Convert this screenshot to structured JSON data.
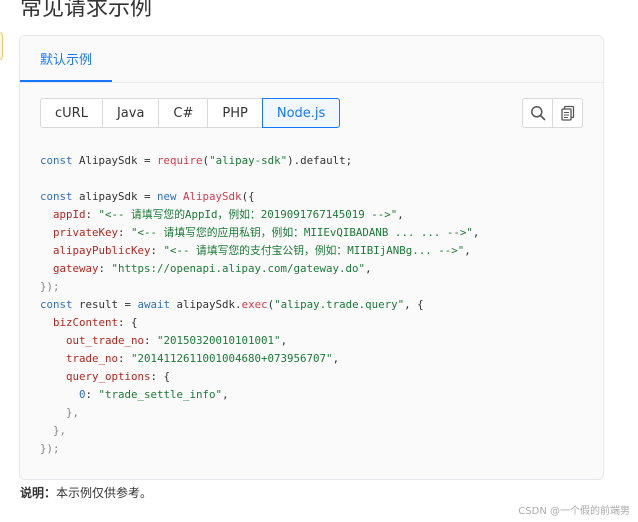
{
  "page": {
    "title": "常见请求示例"
  },
  "card": {
    "tab_label": "默认示例"
  },
  "languages": [
    "cURL",
    "Java",
    "C#",
    "PHP",
    "Node.js"
  ],
  "active_language": "Node.js",
  "code": {
    "l1": {
      "kw": "const",
      "a": " AlipaySdk = ",
      "fn": "require",
      "s": "\"alipay-sdk\"",
      "b": ").default;"
    },
    "l2": {
      "kw": "const",
      "a": " alipaySdk = ",
      "kw2": "new",
      "fn": " AlipaySdk",
      "b": "({"
    },
    "l3": {
      "prop": "appId",
      "str": "\"<-- 请填写您的AppId，例如：2019091767145019 -->\""
    },
    "l4": {
      "prop": "privateKey",
      "str": "\"<-- 请填写您的应用私钥，例如：MIIEvQIBADANB ... ... -->\""
    },
    "l5": {
      "prop": "alipayPublicKey",
      "str": "\"<-- 请填写您的支付宝公钥，例如：MIIBIjANBg... -->\""
    },
    "l6": {
      "prop": "gateway",
      "str": "\"https://openapi.alipay.com/gateway.do\""
    },
    "l7": "});",
    "l8": {
      "kw": "const",
      "a": " result = ",
      "kw2": "await",
      "b": " alipaySdk.",
      "fn": "exec",
      "s": "\"alipay.trade.query\"",
      "c": ", {"
    },
    "l9": {
      "prop": "bizContent",
      "b": ": {"
    },
    "l10": {
      "prop": "out_trade_no",
      "str": "\"20150320010101001\""
    },
    "l11": {
      "prop": "trade_no",
      "str": "\"2014112611001004680+073956707\""
    },
    "l12": {
      "prop": "query_options",
      "b": ": {"
    },
    "l13": {
      "num": "0",
      "str": "\"trade_settle_info\""
    },
    "l14": "},",
    "l15": "},",
    "l16": "});"
  },
  "note": {
    "label": "说明：",
    "text": "本示例仅供参考。"
  },
  "watermark": "CSDN @一个假的前端男",
  "colors": {
    "accent": "#1677ff",
    "keyword": "#2f6fbf",
    "string": "#1a7a36",
    "property": "#b5261e",
    "function": "#d73a49"
  },
  "icons": {
    "search": "search-icon",
    "copy": "copy-icon"
  }
}
